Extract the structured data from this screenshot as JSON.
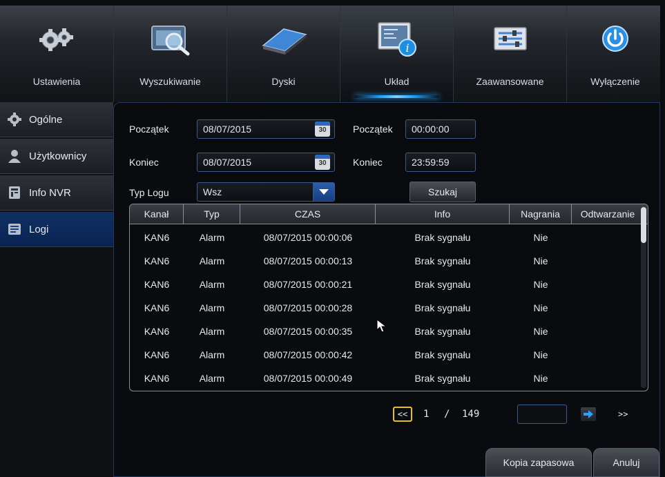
{
  "nav": {
    "tabs": [
      {
        "label": "Ustawienia",
        "icon": "gears-icon"
      },
      {
        "label": "Wyszukiwanie",
        "icon": "search-video-icon"
      },
      {
        "label": "Dyski",
        "icon": "disk-icon"
      },
      {
        "label": "Układ",
        "icon": "system-info-icon",
        "active": true
      },
      {
        "label": "Zaawansowane",
        "icon": "sliders-icon"
      },
      {
        "label": "Wyłączenie",
        "icon": "power-icon"
      }
    ]
  },
  "sidebar": {
    "items": [
      {
        "label": "Ogólne",
        "icon": "gear-icon"
      },
      {
        "label": "Użytkownicy",
        "icon": "user-icon"
      },
      {
        "label": "Info NVR",
        "icon": "info-icon"
      },
      {
        "label": "Logi",
        "icon": "log-icon",
        "active": true
      }
    ]
  },
  "filters": {
    "start_label": "Początek",
    "start_date": "08/07/2015",
    "end_label": "Koniec",
    "end_date": "08/07/2015",
    "start_time_label": "Początek",
    "start_time": "00:00:00",
    "end_time_label": "Koniec",
    "end_time": "23:59:59",
    "type_label": "Typ Logu",
    "type_value": "Wsz",
    "calendar_day": "30",
    "search_button": "Szukaj"
  },
  "table": {
    "headers": [
      "Kanał",
      "Typ",
      "CZAS",
      "Info",
      "Nagrania",
      "Odtwarzanie"
    ],
    "rows": [
      [
        "KAN6",
        "Alarm",
        "08/07/2015 00:00:06",
        "Brak sygnału",
        "Nie",
        ""
      ],
      [
        "KAN6",
        "Alarm",
        "08/07/2015 00:00:13",
        "Brak sygnału",
        "Nie",
        ""
      ],
      [
        "KAN6",
        "Alarm",
        "08/07/2015 00:00:21",
        "Brak sygnału",
        "Nie",
        ""
      ],
      [
        "KAN6",
        "Alarm",
        "08/07/2015 00:00:28",
        "Brak sygnału",
        "Nie",
        ""
      ],
      [
        "KAN6",
        "Alarm",
        "08/07/2015 00:00:35",
        "Brak sygnału",
        "Nie",
        ""
      ],
      [
        "KAN6",
        "Alarm",
        "08/07/2015 00:00:42",
        "Brak sygnału",
        "Nie",
        ""
      ],
      [
        "KAN6",
        "Alarm",
        "08/07/2015 00:00:49",
        "Brak sygnału",
        "Nie",
        ""
      ]
    ]
  },
  "pagination": {
    "prev": "<<",
    "current": "1",
    "separator": "/",
    "total": "149",
    "next": ">>"
  },
  "footer": {
    "backup_button": "Kopia zapasowa",
    "cancel_button": "Anuluj"
  },
  "colors": {
    "accent": "#1ea0ff",
    "active_sidebar": "#0f2f63",
    "page_prev_border": "#e6c21a"
  }
}
